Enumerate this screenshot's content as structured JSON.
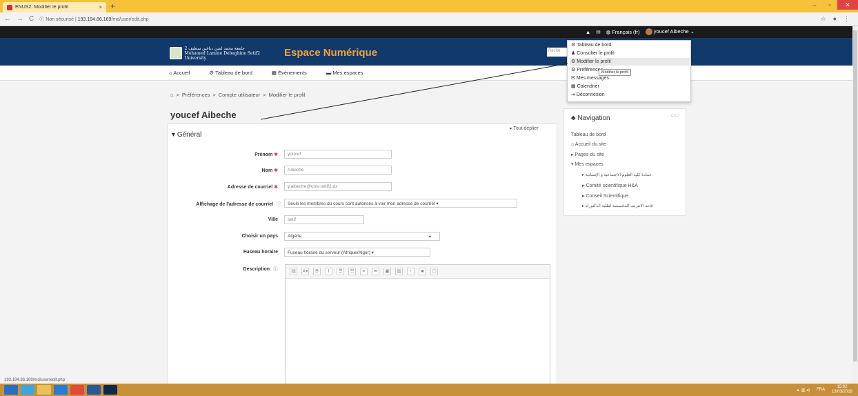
{
  "browser": {
    "tab_title": "ENUS2: Modifier le profil",
    "tab_close": "×",
    "new_tab": "+",
    "security": "Non sécurisé",
    "url_host": "193.194.86.169",
    "url_path": "/md/user/edit.php",
    "back": "←",
    "forward": "→",
    "reload": "C",
    "star": "☆",
    "menu": "⋮",
    "min": "–",
    "max": "▫",
    "close": "✕"
  },
  "topbar": {
    "bell_icon": "bell-icon",
    "message_icon": "message-icon",
    "language": "Français (fr)",
    "user_name": "youcef Aibeche",
    "chevron": "⌄"
  },
  "header": {
    "logo_text_ar": "جامعة محمد لمين دباغين سطيف 2",
    "logo_text_en": "Mohamed Lamine Debaghine Setif2 University",
    "site_name": "Espace Numérique",
    "search_placeholder": "Reche"
  },
  "menu": {
    "items": [
      {
        "icon": "⌂",
        "label": "Accueil"
      },
      {
        "icon": "⚙",
        "label": "Tableau de bord"
      },
      {
        "icon": "▦",
        "label": "Événements"
      },
      {
        "icon": "▬",
        "label": "Mes espaces"
      }
    ]
  },
  "breadcrumb": {
    "home_icon": "⌂",
    "items": [
      "Préférences",
      "Compte utilisateur",
      "Modifier le profil"
    ],
    "sep": ">"
  },
  "page": {
    "title": "youcef Aibeche",
    "expand_all": "Tout déplier",
    "section": "Général"
  },
  "form": {
    "required_mark": "✱",
    "help_mark": "ⓘ",
    "firstname_label": "Prénom",
    "firstname_value": "youcef",
    "lastname_label": "Nom",
    "lastname_value": "Aibeche",
    "email_label": "Adresse de courriel",
    "email_value": "y.aibeche@univ-setif2.dz",
    "email_display_label": "Affichage de l'adresse de courriel",
    "email_display_value": "Seuls les membres du cours sont autorisés à voir mon adresse de courriel",
    "city_label": "Ville",
    "city_value": "setif",
    "country_label": "Choisir un pays",
    "country_value": "Algérie",
    "timezone_label": "Fuseau horaire",
    "timezone_value": "Fuseau horaire du serveur (Afrique/Alger)",
    "description_label": "Description"
  },
  "editor_toolbar": [
    "▤",
    "A▾",
    "B",
    "I",
    "☰",
    "☷",
    "⚭",
    "⚮",
    "▣",
    "▥",
    "♆",
    "■",
    "▢"
  ],
  "nav_block": {
    "title": "Navigation",
    "controls": "▭▭",
    "items": [
      "Tableau de bord",
      "Accueil du site",
      "Pages du site",
      "Mes espaces",
      "عمادة كلية العلوم الاجتماعية و الإنسانية",
      "Comité scientifique H&A",
      "Conseil Scientifique",
      "قاعة الانترنت المخصصة لطلبة الدكتوراه"
    ]
  },
  "user_menu": {
    "items": [
      {
        "icon": "⚙",
        "label": "Tableau de bord"
      },
      {
        "icon": "♟",
        "label": "Consulter le profil"
      },
      {
        "icon": "⚙",
        "label": "Modifier le profil"
      },
      {
        "icon": "⚙",
        "label": "Préférences"
      },
      {
        "icon": "✉",
        "label": "Mes messages"
      },
      {
        "icon": "▦",
        "label": "Calendrier"
      },
      {
        "icon": "⇥",
        "label": "Déconnexion"
      }
    ],
    "tooltip": "Modifier le profil"
  },
  "status_url": "193.194.86.169/md/user/edit.php",
  "taskbar": {
    "lang": "FRA",
    "time": "15:02",
    "date": "13/03/2019"
  },
  "colors": {
    "header_bg": "#12396b",
    "site_name": "#f0a23a",
    "taskbar": "#c88f3a",
    "tabstrip": "#f5c23a"
  }
}
